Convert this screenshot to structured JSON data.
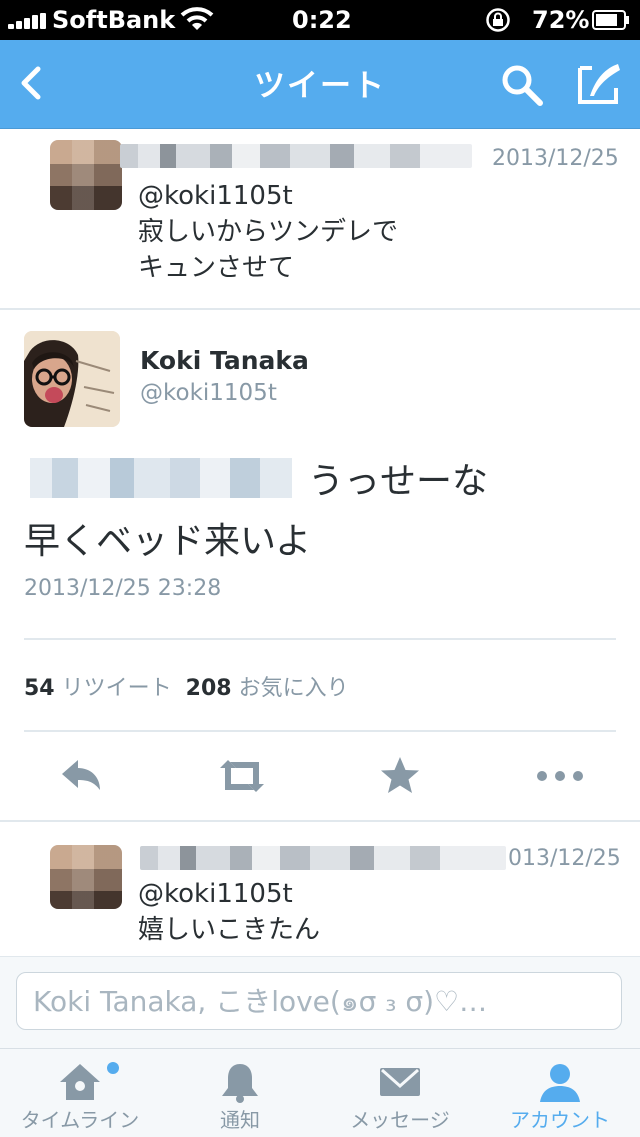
{
  "status": {
    "carrier": "SoftBank",
    "time": "0:22",
    "battery": "72%"
  },
  "nav": {
    "title": "ツイート"
  },
  "reply1": {
    "date": "2013/12/25",
    "handle": "@koki1105t",
    "line1": "寂しいからツンデレで",
    "line2": "キュンさせて"
  },
  "tweet": {
    "name": "Koki Tanaka",
    "handle": "@koki1105t",
    "line1": "うっせーな",
    "line2": "早くベッド来いよ",
    "timestamp": "2013/12/25 23:28",
    "retweet_count": "54",
    "retweet_label": "リツイート",
    "favorite_count": "208",
    "favorite_label": "お気に入り"
  },
  "reply2": {
    "date": "013/12/25",
    "handle": "@koki1105t",
    "line1": "嬉しいこきたん"
  },
  "compose": {
    "placeholder": "Koki Tanaka, こきlove(๑σ ₃ σ)♡…"
  },
  "tabs": [
    {
      "label": "タイムライン",
      "icon": "home-icon"
    },
    {
      "label": "通知",
      "icon": "bell-icon"
    },
    {
      "label": "メッセージ",
      "icon": "envelope-icon"
    },
    {
      "label": "アカウント",
      "icon": "person-icon"
    }
  ],
  "colors": {
    "accent": "#55acee",
    "muted": "#8899a6",
    "text": "#292f33"
  }
}
